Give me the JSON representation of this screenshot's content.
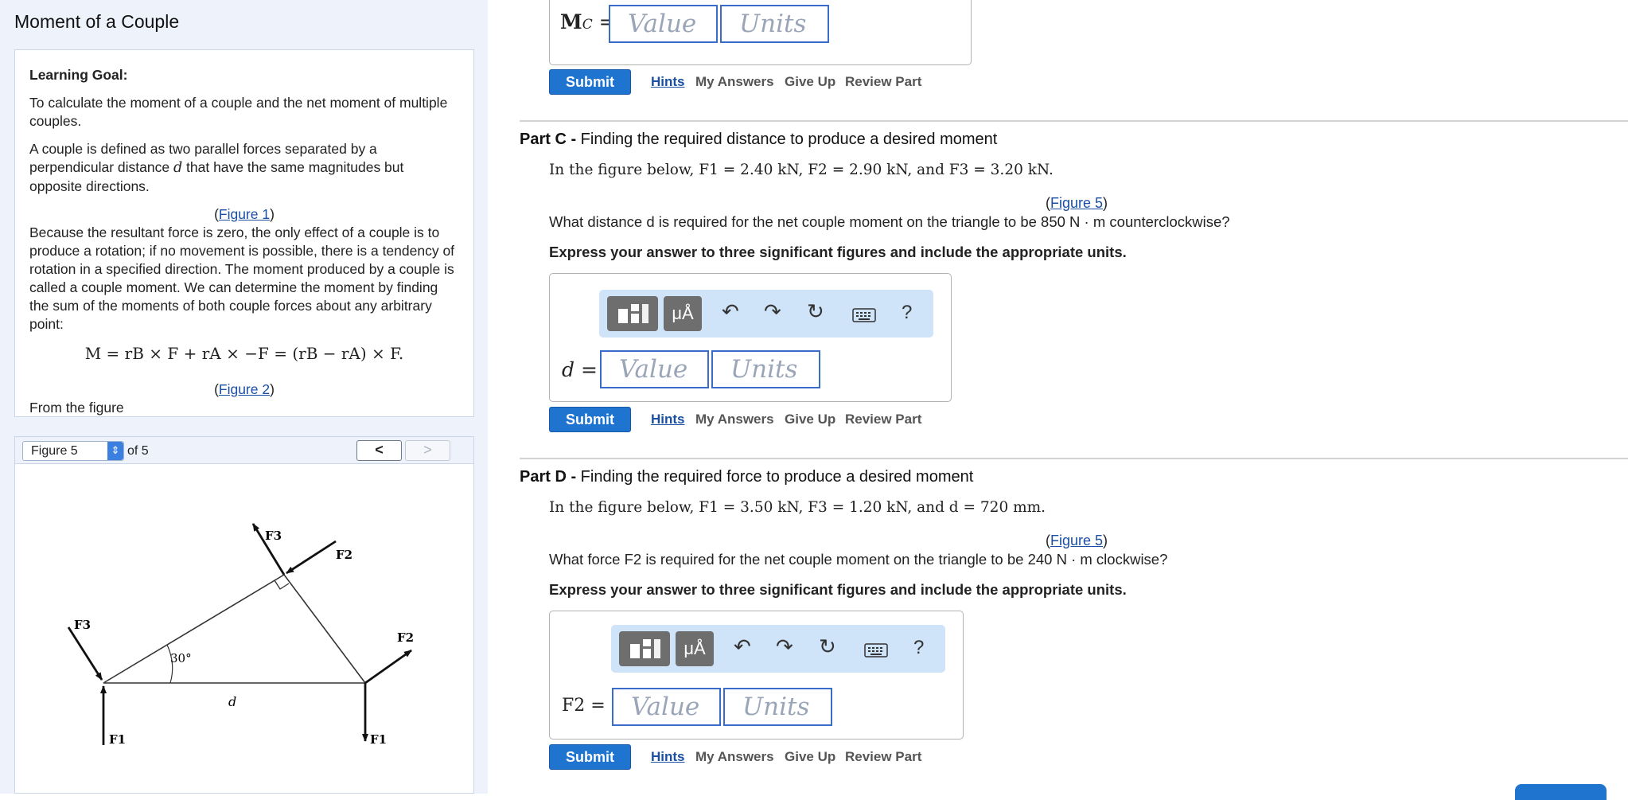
{
  "page_title": "Moment of a Couple",
  "intro": {
    "heading": "Learning Goal:",
    "goal": "To calculate the moment of a couple and the net moment of multiple couples.",
    "def_a": "A couple is defined as two parallel forces separated by a perpendicular distance ",
    "def_var": "d",
    "def_b": " that have the same magnitudes but opposite directions.",
    "fig1": "Figure 1",
    "because": "Because the resultant force is zero, the only effect of a couple is to produce a rotation; if no movement is possible, there is a tendency of rotation in a specified direction. The moment produced by a couple is called a couple moment. We can determine the moment by finding the sum of the moments of both couple forces about any arbitrary point:",
    "equation": "M = rB × F + rA × −F = (rB − rA) × F.",
    "fig2": "Figure 2",
    "from": "From the figure"
  },
  "figure_nav": {
    "selected": "Figure 5",
    "of": "of 5",
    "prev": "<",
    "next": ">"
  },
  "figure": {
    "f1": "F1",
    "f2": "F2",
    "f3": "F3",
    "angle": "30°",
    "d": "d"
  },
  "part_b_tail": {
    "label": "MC =",
    "value_placeholder": "Value",
    "units_placeholder": "Units"
  },
  "actions": {
    "submit": "Submit",
    "hints": "Hints",
    "my_answers": "My Answers",
    "give_up": "Give Up",
    "review": "Review Part"
  },
  "toolbar": {
    "mu": "μÅ",
    "undo": "↶",
    "redo": "↷",
    "reset": "↻",
    "help": "?"
  },
  "part_c": {
    "prefix": "Part C -",
    "title": " Finding the required distance to produce a desired moment",
    "given": "In the figure below, F1 = 2.40 kN, F2 = 2.90 kN, and F3 = 3.20 kN.",
    "fig": "Figure 5",
    "question": "What distance d is required for the net couple moment on the triangle to be 850 N · m counterclockwise?",
    "instr": "Express your answer to three significant figures and include the appropriate units.",
    "label": "d =",
    "value_placeholder": "Value",
    "units_placeholder": "Units"
  },
  "part_d": {
    "prefix": "Part D -",
    "title": " Finding the required force to produce a desired moment",
    "given": "In the figure below, F1 = 3.50 kN, F3 = 1.20 kN, and d = 720 mm.",
    "fig": "Figure 5",
    "question": "What force F2 is required for the net couple moment on the triangle to be 240 N · m clockwise?",
    "instr": "Express your answer to three significant figures and include the appropriate units.",
    "label": "F2 =",
    "value_placeholder": "Value",
    "units_placeholder": "Units"
  }
}
